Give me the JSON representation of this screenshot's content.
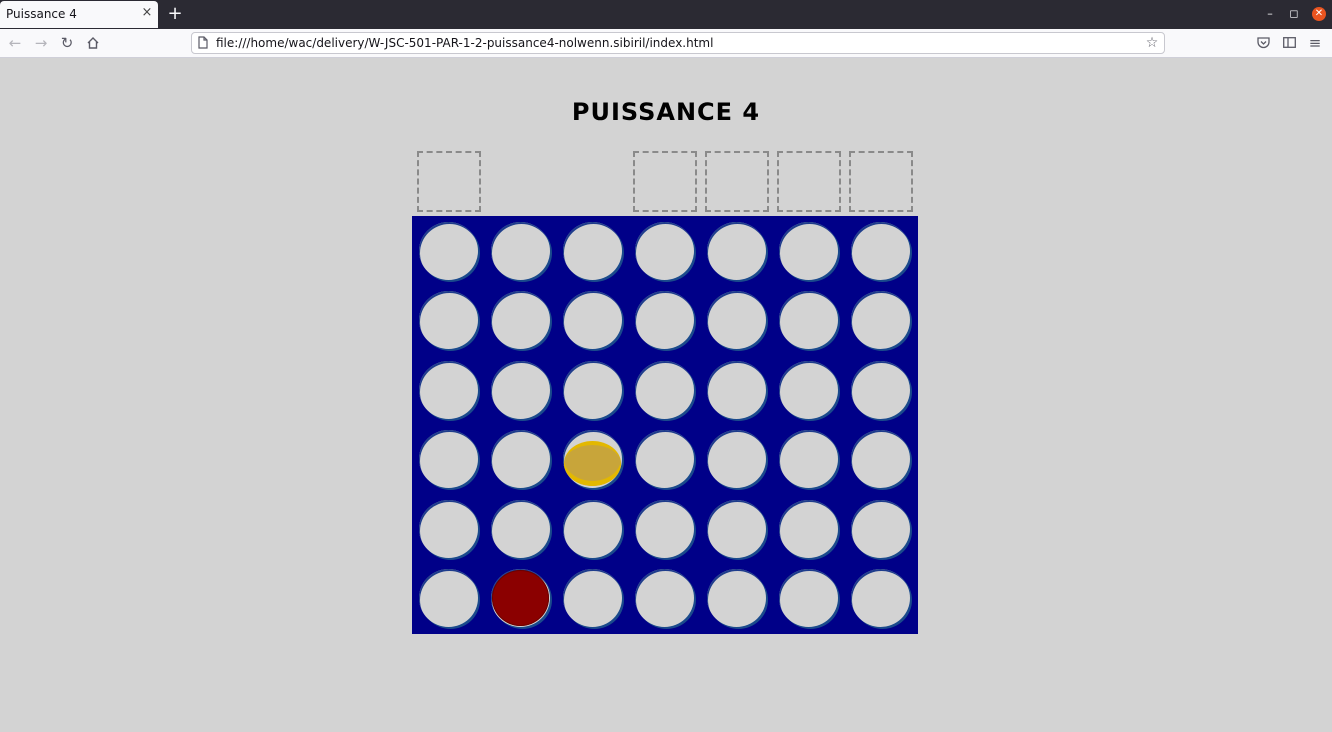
{
  "browser": {
    "tab_title": "Puissance 4",
    "tab_close": "×",
    "new_tab": "+",
    "url": "file:///home/wac/delivery/W-JSC-501-PAR-1-2-puissance4-nolwenn.sibiril/index.html",
    "window_controls": {
      "minimize": "–",
      "maximize": "◻",
      "close": "✕"
    },
    "nav_icons": [
      "back-icon",
      "forward-icon",
      "reload-icon",
      "home-icon"
    ],
    "toolbar_icons": [
      "pocket-icon",
      "sidebar-icon",
      "menu-icon"
    ]
  },
  "game": {
    "title": "PUISSANCE 4",
    "columns": 7,
    "rows": 6,
    "drop_slots": [
      true,
      false,
      false,
      true,
      true,
      true,
      true
    ],
    "colors": {
      "board": "#000088",
      "empty": "#d3d3d3",
      "red": "#8b0000",
      "yellow": "#e3b800"
    },
    "board": [
      [
        "empty",
        "empty",
        "empty",
        "empty",
        "empty",
        "empty",
        "empty"
      ],
      [
        "empty",
        "empty",
        "empty",
        "empty",
        "empty",
        "empty",
        "empty"
      ],
      [
        "empty",
        "empty",
        "empty",
        "empty",
        "empty",
        "empty",
        "empty"
      ],
      [
        "empty",
        "empty",
        "yellow",
        "empty",
        "empty",
        "empty",
        "empty"
      ],
      [
        "empty",
        "empty",
        "empty",
        "empty",
        "empty",
        "empty",
        "empty"
      ],
      [
        "empty",
        "red",
        "empty",
        "empty",
        "empty",
        "empty",
        "empty"
      ]
    ]
  }
}
